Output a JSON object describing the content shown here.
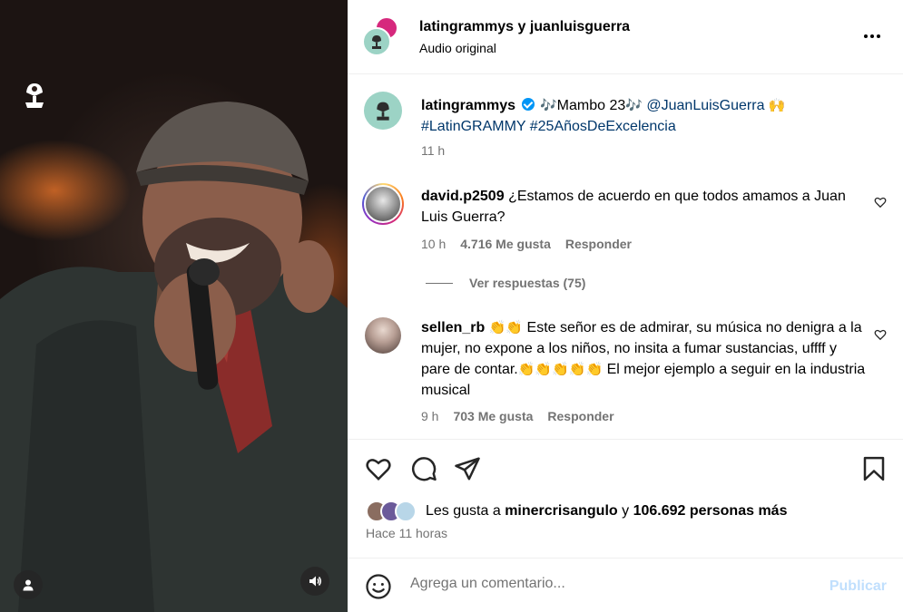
{
  "header": {
    "title": "latingrammys y juanluisguerra",
    "subtitle": "Audio original"
  },
  "caption": {
    "username": "latingrammys",
    "text_part1": "Mambo 23",
    "mention": "@JuanLuisGuerra",
    "hashtags": "#LatinGRAMMY #25AñosDeExcelencia",
    "emoji_music": "🎶",
    "emoji_hands": "🙌",
    "time": "11 h"
  },
  "comments": [
    {
      "username": "david.p2509",
      "text": "¿Estamos de acuerdo en que todos amamos a Juan Luis Guerra?",
      "time": "10 h",
      "likes": "4.716 Me gusta",
      "reply": "Responder"
    },
    {
      "username": "sellen_rb",
      "emoji_lead": "👏👏",
      "text_part1": "Este señor es de admirar, su música no denigra a la mujer, no expone a los niños, no insita a fumar sustancias, uffff y pare de contar.",
      "emoji_mid": "👏👏👏👏👏",
      "text_part2": "El mejor ejemplo a seguir en la industria musical",
      "time": "9 h",
      "likes": "703 Me gusta",
      "reply": "Responder"
    }
  ],
  "replies_toggle": "Ver respuestas (75)",
  "likes": {
    "prefix": "Les gusta a",
    "user": "minercrisangulo",
    "middle": "y",
    "count": "106.692 personas más"
  },
  "time_ago": "Hace 11 horas",
  "add_comment": {
    "placeholder": "Agrega un comentario...",
    "publish": "Publicar"
  },
  "icons": [
    "grammy-logo-icon",
    "user-icon",
    "volume-icon",
    "more-icon",
    "verified-icon",
    "heart-icon",
    "comment-icon",
    "share-icon",
    "bookmark-icon",
    "emoji-icon"
  ],
  "colors": {
    "link": "#00376b",
    "muted": "#737373",
    "verified": "#0095f6",
    "publish_disabled": "#c0dffd"
  }
}
